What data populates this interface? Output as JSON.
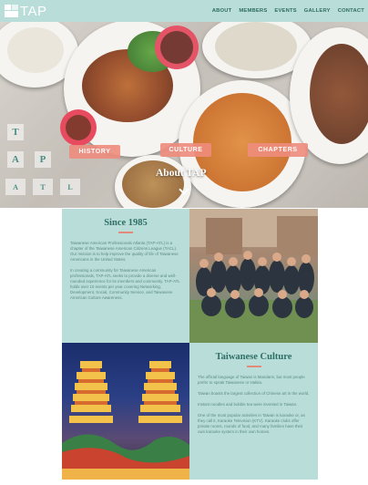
{
  "site": {
    "logo_text": "TAP",
    "nav": [
      "ABOUT",
      "MEMBERS",
      "EVENTS",
      "GALLERY",
      "CONTACT"
    ]
  },
  "hero": {
    "buttons": [
      "HISTORY",
      "CULTURE",
      "CHAPTERS"
    ],
    "title": "About TAP",
    "tiles": [
      "T",
      "A",
      "P",
      "A",
      "T",
      "L"
    ]
  },
  "since": {
    "title": "Since 1985",
    "para1": "Taiwanese American Professionals Atlanta (TAP-ATL) is a chapter of the Taiwanese American Citizens League (TACL). Our mission is to help improve the quality of life of Taiwanese Americans in the United States.",
    "para2": "In creating a community for Taiwanese American professionals, TAP-ATL seeks to provide a diverse and well-rounded experience for its members and community. TAP-ATL holds over 10 events per year covering Networking, Development, Social, Community Service, and Taiwanese American Culture Awareness."
  },
  "culture": {
    "title": "Taiwanese Culture",
    "para1": "The official language of Taiwan is Mandarin, but most people prefer to speak Taiwanese or Hakka.",
    "para2": "Taiwan boasts the largest collection of Chinese art in the world.",
    "para3": "Instant noodles and bubble tea were invented in Taiwan.",
    "para4": "One of the most popular activities in Taiwan is karaoke or, as they call it, Karaoke Television (KTV). Karaoke clubs offer private rooms, rounds of food, and many families have their own karaoke system in their own homes."
  },
  "colors": {
    "nav_bg": "#b9ded9",
    "accent": "#ee8c7d",
    "heading": "#2f6e66"
  },
  "icons": [
    "logo-mark-icon",
    "chevron-down-icon"
  ]
}
